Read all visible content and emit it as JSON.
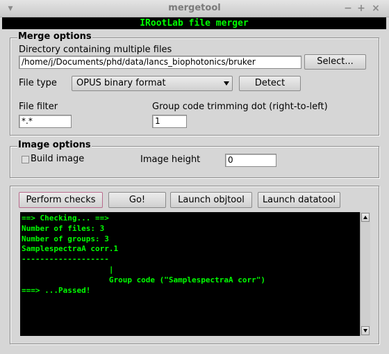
{
  "window": {
    "title": "mergetool",
    "menu_glyph": "▾",
    "minimize_glyph": "−",
    "maximize_glyph": "+",
    "close_glyph": "×"
  },
  "banner": "IRootLab file merger",
  "merge_options": {
    "title": "Merge options",
    "dir_label": "Directory containing multiple files",
    "dir_value": "/home/j/Documents/phd/data/lancs_biophotonics/bruker",
    "select_label": "Select...",
    "file_type_label": "File type",
    "file_type_value": "OPUS binary format",
    "detect_label": "Detect",
    "file_filter_label": "File filter",
    "file_filter_value": "*.*",
    "trim_label": "Group code trimming dot (right-to-left)",
    "trim_value": "1"
  },
  "image_options": {
    "title": "Image options",
    "build_image_label": "Build image",
    "build_image_checked": false,
    "image_height_label": "Image height",
    "image_height_value": "0"
  },
  "actions": {
    "perform_checks": "Perform checks",
    "go": "Go!",
    "launch_objtool": "Launch objtool",
    "launch_datatool": "Launch datatool"
  },
  "console": {
    "text": "==> Checking... ==>\nNumber of files: 3\nNumber of groups: 3\nSamplespectraA corr.1\n-------------------\n                   |\n                   Group code (\"SamplespectraA corr\")\n===> ...Passed!"
  },
  "colors": {
    "console_fg": "#00ff00",
    "console_bg": "#000000",
    "window_bg": "#d6d6d6"
  }
}
